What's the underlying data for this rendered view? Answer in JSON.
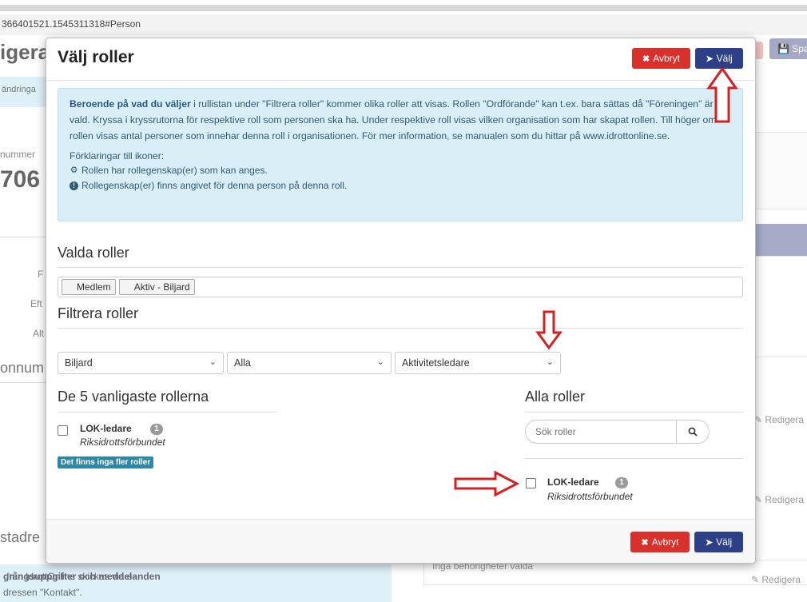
{
  "background": {
    "url_fragment": "366401521.1545311318#Person",
    "heading_partial": "igera",
    "spara_partial": "Spa",
    "info_partial": "ändringa",
    "label_nummer": "nummer",
    "big_number_partial": "706",
    "label_f": "F",
    "label_eft": "Eft",
    "label_alt": "Alt",
    "section_partial_1": "onnum",
    "section_partial_2": "stadre",
    "edit_label": "Redigera",
    "bottom_left_line1_bold": "gningsuppgifter och meddelanden",
    "bottom_left_line1_rest": " från IdrottOnline skickas via e-",
    "bottom_left_line2": "dressen \"Kontakt\".",
    "bottom_right_text": "Inga behörigheter valda"
  },
  "modal": {
    "title": "Välj roller",
    "cancel_label": "Avbryt",
    "select_label": "Välj",
    "info": {
      "bold_intro": "Beroende på vad du väljer",
      "text": " i rullistan under \"Filtrera roller\" kommer olika roller att visas. Rollen \"Ordförande\" kan t.ex. bara sättas då \"Föreningen\" är vald. Kryssa i kryssrutorna för respektive roll som personen ska ha. Under respektive roll visas vilken organisation som har skapat rollen. Till höger om rollen visas antal personer som innehar denna roll i organisationen. För mer information, se manualen som du hittar på www.idrottonline.se.",
      "legend_title": "Förklaringar till ikoner:",
      "legend_gear": "Rollen har rollegenskap(er) som kan anges.",
      "legend_exclamation": "Rollegenskap(er) finns angivet för denna person på denna roll."
    },
    "selected_title": "Valda roller",
    "selected_tags": [
      "Medlem",
      "Aktiv - Biljard"
    ],
    "filter_title": "Filtrera roller",
    "filters": [
      "Biljard",
      "Alla",
      "Aktivitetsledare"
    ],
    "common_title": "De 5 vanligaste rollerna",
    "all_title": "Alla roller",
    "search_placeholder": "Sök roller",
    "common_roles": [
      {
        "name": "LOK-ledare",
        "count": "1",
        "org": "Riksidrottsförbundet"
      }
    ],
    "no_more_label": "Det finns inga fler roller",
    "all_roles": [
      {
        "name": "LOK-ledare",
        "count": "1",
        "org": "Riksidrottsförbundet"
      }
    ]
  },
  "colors": {
    "cancel": "#d9302c",
    "select": "#2d3f86",
    "info_bg": "#d9eef6",
    "arrow": "#d42020"
  }
}
